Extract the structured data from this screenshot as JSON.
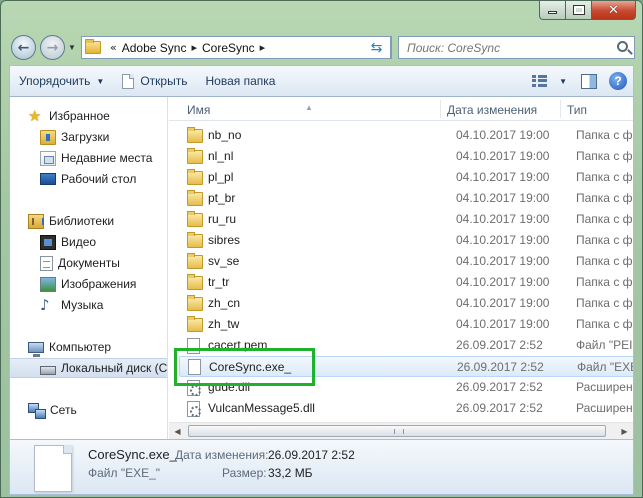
{
  "window": {
    "caption_min": "",
    "caption_max": "",
    "caption_close": "✕"
  },
  "address": {
    "overflow": "«",
    "crumbs": [
      "Adobe Sync",
      "CoreSync"
    ],
    "search_placeholder": "Поиск: CoreSync"
  },
  "toolbar": {
    "organize": "Упорядочить",
    "open": "Открыть",
    "new_folder": "Новая папка"
  },
  "nav": {
    "favorites": "Избранное",
    "downloads": "Загрузки",
    "recent": "Недавние места",
    "desktop": "Рабочий стол",
    "libraries": "Библиотеки",
    "video": "Видео",
    "documents": "Документы",
    "images": "Изображения",
    "music": "Музыка",
    "computer": "Компьютер",
    "local_disk": "Локальный диск (C",
    "network": "Сеть"
  },
  "columns": {
    "name": "Имя",
    "date": "Дата изменения",
    "type": "Тип"
  },
  "files": [
    {
      "name": "nb_no",
      "date": "04.10.2017 19:00",
      "type": "Папка с ф"
    },
    {
      "name": "nl_nl",
      "date": "04.10.2017 19:00",
      "type": "Папка с ф"
    },
    {
      "name": "pl_pl",
      "date": "04.10.2017 19:00",
      "type": "Папка с ф"
    },
    {
      "name": "pt_br",
      "date": "04.10.2017 19:00",
      "type": "Папка с ф"
    },
    {
      "name": "ru_ru",
      "date": "04.10.2017 19:00",
      "type": "Папка с ф"
    },
    {
      "name": "sibres",
      "date": "04.10.2017 19:00",
      "type": "Папка с ф"
    },
    {
      "name": "sv_se",
      "date": "04.10.2017 19:00",
      "type": "Папка с ф"
    },
    {
      "name": "tr_tr",
      "date": "04.10.2017 19:00",
      "type": "Папка с ф"
    },
    {
      "name": "zh_cn",
      "date": "04.10.2017 19:00",
      "type": "Папка с ф"
    },
    {
      "name": "zh_tw",
      "date": "04.10.2017 19:00",
      "type": "Папка с ф"
    },
    {
      "name": "cacert.pem",
      "date": "26.09.2017 2:52",
      "type": "Файл \"PEI"
    },
    {
      "name": "CoreSync.exe_",
      "date": "26.09.2017 2:52",
      "type": "Файл \"EXE"
    },
    {
      "name": "gude.dll",
      "date": "26.09.2017 2:52",
      "type": "Расширен"
    },
    {
      "name": "VulcanMessage5.dll",
      "date": "26.09.2017 2:52",
      "type": "Расширен"
    }
  ],
  "details": {
    "name": "CoreSync.exe_",
    "kind": "Файл \"EXE_\"",
    "modified_label": "Дата изменения:",
    "modified_value": "26.09.2017 2:52",
    "size_label": "Размер:",
    "size_value": "33,2 МБ"
  }
}
